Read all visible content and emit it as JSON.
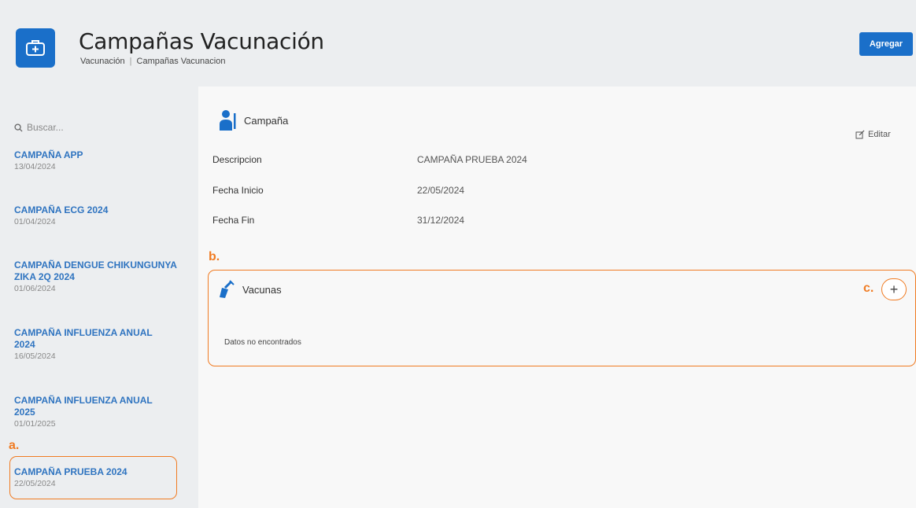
{
  "header": {
    "title": "Campañas Vacunación",
    "breadcrumb": [
      "Vacunación",
      "Campañas Vacunacion"
    ],
    "add_label": "Agregar",
    "app_icon": "medical-bag-icon"
  },
  "sidebar": {
    "search_placeholder": "Buscar...",
    "items": [
      {
        "name": "CAMPAÑA APP",
        "date": "13/04/2024"
      },
      {
        "name": "CAMPAÑA ECG 2024",
        "date": "01/04/2024"
      },
      {
        "name": "CAMPAÑA DENGUE CHIKUNGUNYA ZIKA 2Q 2024",
        "date": "01/06/2024"
      },
      {
        "name": "CAMPAÑA INFLUENZA ANUAL 2024",
        "date": "16/05/2024"
      },
      {
        "name": "CAMPAÑA INFLUENZA ANUAL 2025",
        "date": "01/01/2025"
      },
      {
        "name": "CAMPAÑA PRUEBA 2024",
        "date": "22/05/2024"
      }
    ]
  },
  "campaign": {
    "section_title": "Campaña",
    "edit_label": "Editar",
    "fields": [
      {
        "label": "Descripcion",
        "value": "CAMPAÑA PRUEBA 2024"
      },
      {
        "label": "Fecha Inicio",
        "value": "22/05/2024"
      },
      {
        "label": "Fecha Fin",
        "value": "31/12/2024"
      }
    ]
  },
  "vacunas": {
    "section_title": "Vacunas",
    "empty_text": "Datos no encontrados"
  },
  "annotations": {
    "a": "a.",
    "b": "b.",
    "c": "c."
  },
  "colors": {
    "accent": "#1a6fc9",
    "link": "#2f74c0",
    "highlight": "#f07b22"
  }
}
